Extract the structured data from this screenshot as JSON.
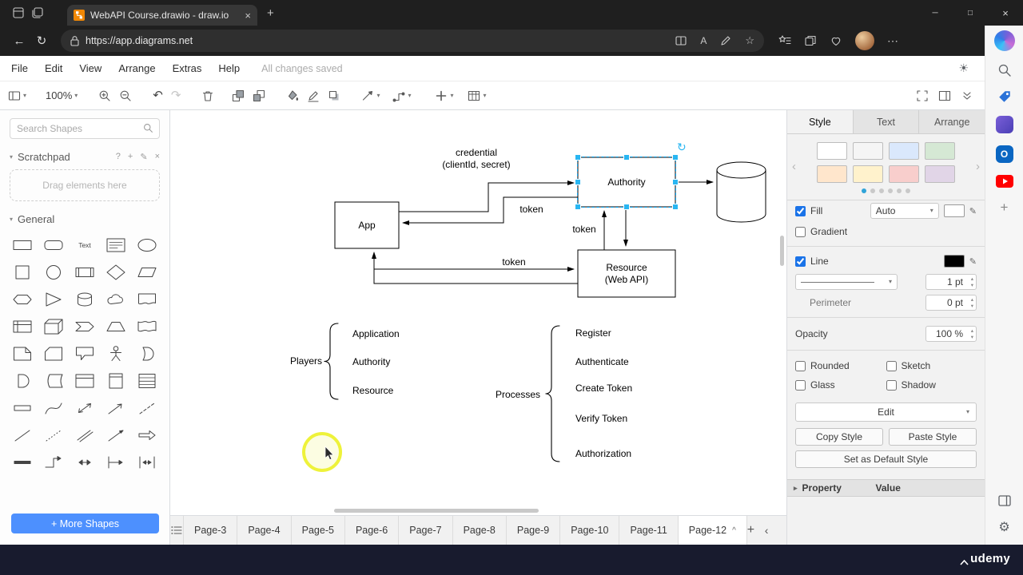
{
  "browser": {
    "tab_title": "WebAPI Course.drawio - draw.io",
    "url": "https://app.diagrams.net"
  },
  "menu": {
    "items": [
      "File",
      "Edit",
      "View",
      "Arrange",
      "Extras",
      "Help"
    ],
    "status": "All changes saved"
  },
  "toolbar": {
    "zoom": "100%"
  },
  "shapes_panel": {
    "search_placeholder": "Search Shapes",
    "scratchpad_title": "Scratchpad",
    "scratchpad_hint": "Drag elements here",
    "general_title": "General",
    "more_shapes_label": "+ More Shapes",
    "shapes": [
      "rectangle",
      "rounded-rectangle",
      "text",
      "textbox",
      "ellipse",
      "square",
      "circle",
      "process",
      "diamond",
      "parallelogram",
      "hexagon",
      "triangle",
      "cylinder",
      "cloud",
      "document",
      "internal-storage",
      "cube",
      "step",
      "trapezoid",
      "tape",
      "note",
      "card",
      "callout",
      "actor",
      "or",
      "and",
      "data-storage",
      "container",
      "vertical-container",
      "list",
      "list-item",
      "curve",
      "bidirectional-arrow",
      "arrow",
      "dashed-line",
      "line",
      "dotted-line",
      "link",
      "directional-connector",
      "thick-arrow",
      "thick-line",
      "elbow-arrow",
      "double-arrow",
      "arrow-bar",
      "bidirectional-bar"
    ]
  },
  "diagram": {
    "nodes": {
      "app": {
        "label": "App"
      },
      "authority": {
        "label": "Authority"
      },
      "resource": {
        "label": "Resource",
        "label2": "(Web API)"
      }
    },
    "edge_labels": {
      "credential_line1": "credential",
      "credential_line2": "(clientId, secret)",
      "token_app": "token",
      "token_vertical": "token",
      "token_resource": "token"
    },
    "players": {
      "label": "Players",
      "items": [
        "Application",
        "Authority",
        "Resource"
      ]
    },
    "processes": {
      "label": "Processes",
      "items": [
        "Register",
        "Authenticate",
        "Create Token",
        "Verify Token",
        "Authorization"
      ]
    }
  },
  "format_panel": {
    "tabs": [
      "Style",
      "Text",
      "Arrange"
    ],
    "active_tab": "Style",
    "preset_rows": [
      [
        "#ffffff",
        "#f5f5f5",
        "#dae8fc",
        "#d5e8d4"
      ],
      [
        "#ffe6cc",
        "#fff2cc",
        "#f8cecc",
        "#e1d5e7"
      ]
    ],
    "preset_dots": {
      "count": 6,
      "active_index": 0
    },
    "fill": {
      "label": "Fill",
      "checked": true,
      "mode": "Auto",
      "color": "#ffffff"
    },
    "gradient": {
      "label": "Gradient",
      "checked": false
    },
    "line": {
      "label": "Line",
      "checked": true,
      "color": "#000000",
      "width": "1 pt"
    },
    "perimeter": {
      "label": "Perimeter",
      "value": "0 pt"
    },
    "opacity": {
      "label": "Opacity",
      "value": "100 %"
    },
    "toggles": [
      {
        "label": "Rounded",
        "checked": false
      },
      {
        "label": "Sketch",
        "checked": false
      },
      {
        "label": "Glass",
        "checked": false
      },
      {
        "label": "Shadow",
        "checked": false
      }
    ],
    "edit_label": "Edit",
    "copy_style_label": "Copy Style",
    "paste_style_label": "Paste Style",
    "set_default_label": "Set as Default Style",
    "property_header": "Property",
    "value_header": "Value"
  },
  "pages": {
    "tabs": [
      "Page-3",
      "Page-4",
      "Page-5",
      "Page-6",
      "Page-7",
      "Page-8",
      "Page-9",
      "Page-10",
      "Page-11",
      "Page-12"
    ],
    "active": "Page-12"
  },
  "footer": {
    "brand": "udemy"
  },
  "colors": {
    "selection": "#29b6f2",
    "selection_dash": "#00a8ff",
    "highlight": "#eef23a",
    "accent_blue": "#4d90fe"
  },
  "icons": {
    "close": "×",
    "add": "+",
    "chevron-down": "▾",
    "chevron-left": "‹",
    "chevron-right": "›",
    "more": "⋯",
    "minimize": "─",
    "maximize": "□",
    "back": "←",
    "refresh": "↻",
    "undo": "↶",
    "redo": "↷",
    "help": "?",
    "edit-pencil": "✎",
    "star": "☆",
    "sun": "☀",
    "gear": "⚙",
    "expander": "▸",
    "page-caret": "^",
    "rotate": "↻",
    "stepper-up": "▴",
    "stepper-down": "▾",
    "section-caret": "▾",
    "outlook": "O",
    "read-aloud": "A"
  }
}
